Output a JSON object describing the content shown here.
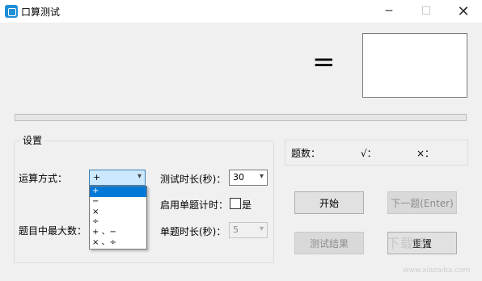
{
  "window": {
    "title": "口算测试",
    "minimize": "─",
    "maximize": "☐",
    "close": "✕"
  },
  "display": {
    "equals": "=",
    "answer_value": "",
    "progress": 0
  },
  "settings": {
    "legend": "设置",
    "operation_label": "运算方式：",
    "operation_value": "+",
    "operation_options": [
      "+",
      "−",
      "×",
      "÷",
      "+ 、−",
      "× 、÷"
    ],
    "max_number_label": "题目中最大数：",
    "test_duration_label": "测试时长(秒)：",
    "test_duration_value": "30",
    "enable_timer_label": "启用单题计时：",
    "enable_timer_checkbox_label": "是",
    "enable_timer_checked": false,
    "per_question_label": "单题时长(秒)：",
    "per_question_value": "5"
  },
  "counts": {
    "total_label": "题数：",
    "correct_label": "√：",
    "wrong_label": "×："
  },
  "buttons": {
    "start": "开始",
    "next": "下一题(Enter)",
    "results": "测试结果",
    "reset": "重置"
  },
  "watermark": {
    "text": "下载吧",
    "sub": "www.xiazaiba.com"
  }
}
